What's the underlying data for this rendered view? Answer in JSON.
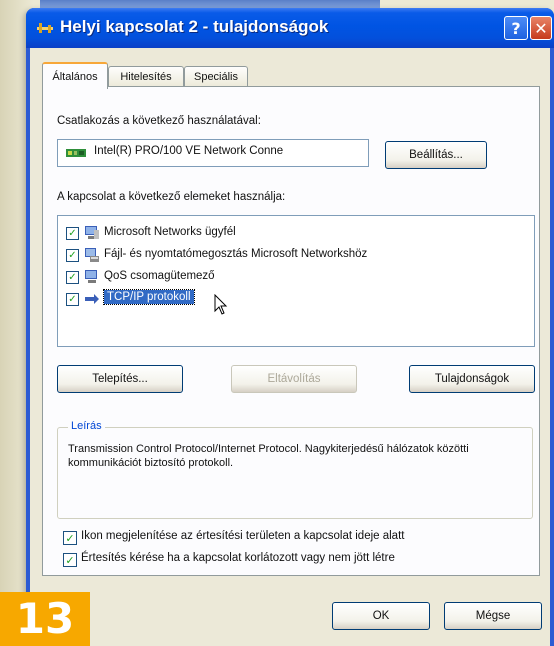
{
  "window": {
    "title": "Helyi kapcsolat 2 - tulajdonságok",
    "help_button": "?",
    "close_button": "✕"
  },
  "tabs": [
    {
      "label": "Általános",
      "active": true
    },
    {
      "label": "Hitelesítés",
      "active": false
    },
    {
      "label": "Speciális",
      "active": false
    }
  ],
  "connection": {
    "label": "Csatlakozás a következő használatával:",
    "adapter": "Intel(R) PRO/100 VE Network Conne",
    "configure_button": "Beállítás..."
  },
  "items_section": {
    "label": "A kapcsolat a következő elemeket használja:",
    "items": [
      {
        "label": "Microsoft Networks ügyfél",
        "checked": true,
        "icon": "network-client-icon"
      },
      {
        "label": "Fájl- és nyomtatómegosztás Microsoft Networkshöz",
        "checked": true,
        "icon": "file-printer-sharing-icon"
      },
      {
        "label": "QoS csomagütemező",
        "checked": true,
        "icon": "qos-scheduler-icon"
      },
      {
        "label": "TCP/IP protokoll",
        "checked": true,
        "icon": "protocol-icon",
        "selected": true
      }
    ]
  },
  "buttons": {
    "install": "Telepítés...",
    "uninstall": "Eltávolítás",
    "properties": "Tulajdonságok",
    "ok": "OK",
    "cancel": "Mégse"
  },
  "description": {
    "legend": "Leírás",
    "text": "Transmission Control Protocol/Internet Protocol. Nagykiterjedésű hálózatok közötti kommunikációt biztosító protokoll."
  },
  "options": [
    {
      "label": "Ikon megjelenítése az értesítési területen a kapcsolat ideje alatt",
      "checked": true
    },
    {
      "label": "Értesítés kérése ha a kapcsolat korlátozott vagy nem jött létre",
      "checked": true
    }
  ],
  "badge": "13",
  "colors": {
    "titlebar": "#0054e3",
    "selection": "#316ac5",
    "badge": "#f7a800",
    "legend": "#0046d5"
  }
}
